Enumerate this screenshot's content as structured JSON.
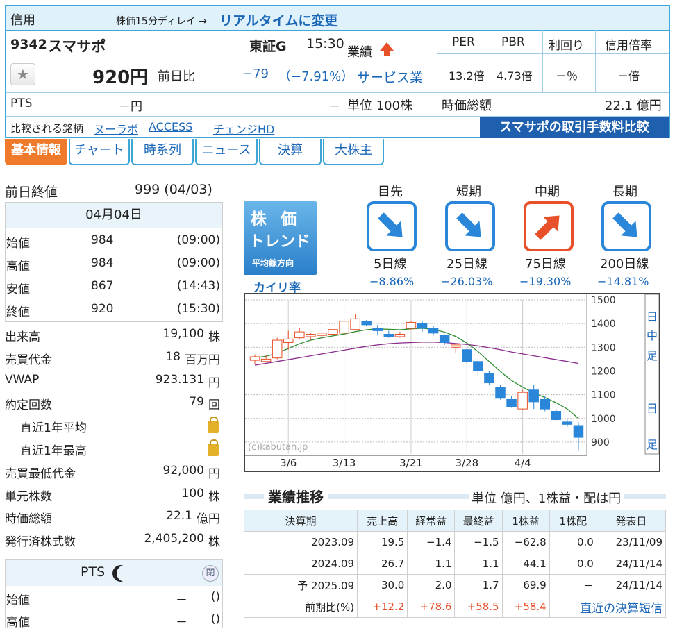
{
  "header": {
    "label": "信用",
    "delay_note": "株価15分ディレイ →",
    "realtime_link": "リアルタイムに変更"
  },
  "stock": {
    "code": "9342",
    "name": "スマサポ",
    "market": "東証G",
    "time": "15:30",
    "price": "920円",
    "change_label": "前日比",
    "change": "−79",
    "change_pct": "（−7.91%）",
    "pts_label": "PTS",
    "pts_price": "－円",
    "pts_change": "－"
  },
  "perf_info": {
    "label": "業績",
    "sector": "サービス業",
    "unit": "単位 100株"
  },
  "metrics": {
    "headers": [
      "PER",
      "PBR",
      "利回り",
      "信用倍率"
    ],
    "values": [
      "13.2倍",
      "4.73倍",
      "－％",
      "－倍"
    ],
    "mcap_label": "時価総額",
    "mcap_value": "22.1 億円"
  },
  "compare": {
    "label": "比較される銘柄",
    "stocks": [
      "ヌーラボ",
      "ACCESS",
      "チェンジHD"
    ],
    "fee_link": "スマサポの取引手数料比較"
  },
  "tabs": [
    "基本情報",
    "チャート",
    "時系列",
    "ニュース",
    "決算",
    "大株主"
  ],
  "prev": {
    "label": "前日終値",
    "value": "999 (04/03)"
  },
  "daily": {
    "date": "04月04日",
    "rows": [
      {
        "label": "始値",
        "value": "984",
        "time": "(09:00)"
      },
      {
        "label": "高値",
        "value": "984",
        "time": "(09:00)"
      },
      {
        "label": "安値",
        "value": "867",
        "time": "(14:43)"
      },
      {
        "label": "終値",
        "value": "920",
        "time": "(15:30)"
      }
    ]
  },
  "stats": [
    {
      "label": "出来高",
      "value": "19,100",
      "unit": "株"
    },
    {
      "label": "売買代金",
      "value": "18",
      "unit": "百万円"
    },
    {
      "label": "VWAP",
      "value": "923.131",
      "unit": "円"
    },
    {
      "label": "約定回数",
      "value": "79",
      "unit": "回"
    },
    {
      "label": "直近1年平均",
      "value": "",
      "unit": ""
    },
    {
      "label": "直近1年最高",
      "value": "",
      "unit": ""
    },
    {
      "label": "売買最低代金",
      "value": "92,000",
      "unit": "円"
    },
    {
      "label": "単元株数",
      "value": "100",
      "unit": "株"
    },
    {
      "label": "時価総額",
      "value": "22.1",
      "unit": "億円"
    },
    {
      "label": "発行済株式数",
      "value": "2,405,200",
      "unit": "株"
    }
  ],
  "pts_box": {
    "title": "PTS",
    "close_label": "閉",
    "rows": [
      {
        "label": "始値",
        "value": "－",
        "time": "()"
      },
      {
        "label": "高値",
        "value": "－",
        "time": "()"
      }
    ]
  },
  "trend": {
    "badge_title": "株 価",
    "badge_sub": "トレンド",
    "badge_note": "平均線方向",
    "kairi_label": "カイリ率",
    "items": [
      {
        "period": "目先",
        "line": "5日線",
        "pct": "−8.86",
        "dir": "down"
      },
      {
        "period": "短期",
        "line": "25日線",
        "pct": "−26.03",
        "dir": "down"
      },
      {
        "period": "中期",
        "line": "75日線",
        "pct": "−19.30",
        "dir": "up"
      },
      {
        "period": "長期",
        "line": "200日線",
        "pct": "−14.81",
        "dir": "down"
      }
    ]
  },
  "chart_data": {
    "type": "candlestick",
    "x": [
      "3/6",
      "3/13",
      "3/21",
      "3/28",
      "4/4"
    ],
    "ylim": [
      850,
      1500
    ],
    "yticks": [
      1500,
      1400,
      1300,
      1200,
      1100,
      1000,
      900
    ],
    "watermark": "(c)kabutan.jp",
    "side_labels": [
      "日",
      "中",
      "足",
      "日",
      "足"
    ],
    "candles": [
      [
        1245,
        1260,
        1230,
        1270
      ],
      [
        1240,
        1250,
        1235,
        1265
      ],
      [
        1255,
        1330,
        1250,
        1340
      ],
      [
        1320,
        1335,
        1290,
        1370
      ],
      [
        1340,
        1365,
        1335,
        1380
      ],
      [
        1345,
        1355,
        1330,
        1360
      ],
      [
        1350,
        1360,
        1345,
        1370
      ],
      [
        1355,
        1375,
        1350,
        1385
      ],
      [
        1360,
        1410,
        1350,
        1420
      ],
      [
        1375,
        1420,
        1370,
        1440
      ],
      [
        1410,
        1395,
        1390,
        1415
      ],
      [
        1380,
        1370,
        1350,
        1395
      ],
      [
        1355,
        1345,
        1340,
        1370
      ],
      [
        1345,
        1355,
        1340,
        1365
      ],
      [
        1380,
        1405,
        1375,
        1410
      ],
      [
        1400,
        1380,
        1365,
        1410
      ],
      [
        1380,
        1360,
        1350,
        1390
      ],
      [
        1350,
        1320,
        1310,
        1355
      ],
      [
        1300,
        1310,
        1275,
        1315
      ],
      [
        1290,
        1240,
        1230,
        1295
      ],
      [
        1240,
        1200,
        1180,
        1250
      ],
      [
        1190,
        1150,
        1140,
        1200
      ],
      [
        1130,
        1085,
        1080,
        1140
      ],
      [
        1080,
        1050,
        1045,
        1095
      ],
      [
        1040,
        1110,
        1035,
        1120
      ],
      [
        1120,
        1070,
        1040,
        1140
      ],
      [
        1080,
        1040,
        1030,
        1095
      ],
      [
        1030,
        995,
        990,
        1040
      ],
      [
        985,
        975,
        965,
        995
      ],
      [
        970,
        920,
        867,
        984
      ]
    ],
    "ma_short": [
      1255,
      1262,
      1275,
      1295,
      1315,
      1330,
      1340,
      1348,
      1356,
      1366,
      1374,
      1378,
      1376,
      1374,
      1378,
      1380,
      1376,
      1364,
      1346,
      1318,
      1282,
      1240,
      1198,
      1160,
      1132,
      1108,
      1088,
      1066,
      1040,
      1000
    ],
    "ma_long": [
      1225,
      1232,
      1240,
      1248,
      1256,
      1264,
      1272,
      1280,
      1288,
      1296,
      1304,
      1310,
      1315,
      1318,
      1320,
      1322,
      1322,
      1320,
      1316,
      1312,
      1306,
      1298,
      1290,
      1280,
      1272,
      1264,
      1256,
      1248,
      1240,
      1232
    ]
  },
  "performance": {
    "title": "業績推移",
    "unit_note": "単位 億円、1株益・配は円",
    "headers": [
      "決算期",
      "売上高",
      "経常益",
      "最終益",
      "1株益",
      "1株配",
      "発表日"
    ],
    "rows": [
      [
        "2023.09",
        "19.5",
        "−1.4",
        "−1.5",
        "−62.8",
        "0.0",
        "23/11/09"
      ],
      [
        "2024.09",
        "26.7",
        "1.1",
        "1.1",
        "44.1",
        "0.0",
        "24/11/14"
      ],
      [
        "予 2025.09",
        "30.0",
        "2.0",
        "1.7",
        "69.9",
        "－",
        "24/11/14"
      ]
    ],
    "yoy": {
      "label": "前期比(%)",
      "values": [
        "+12.2",
        "+78.6",
        "+58.5",
        "+58.4"
      ],
      "link": "直近の決算短信"
    }
  },
  "colors": {
    "accent": "#3fa6d8",
    "tab_active": "#ef7a2b",
    "up": "#e8502a",
    "down": "#2a86d8"
  }
}
